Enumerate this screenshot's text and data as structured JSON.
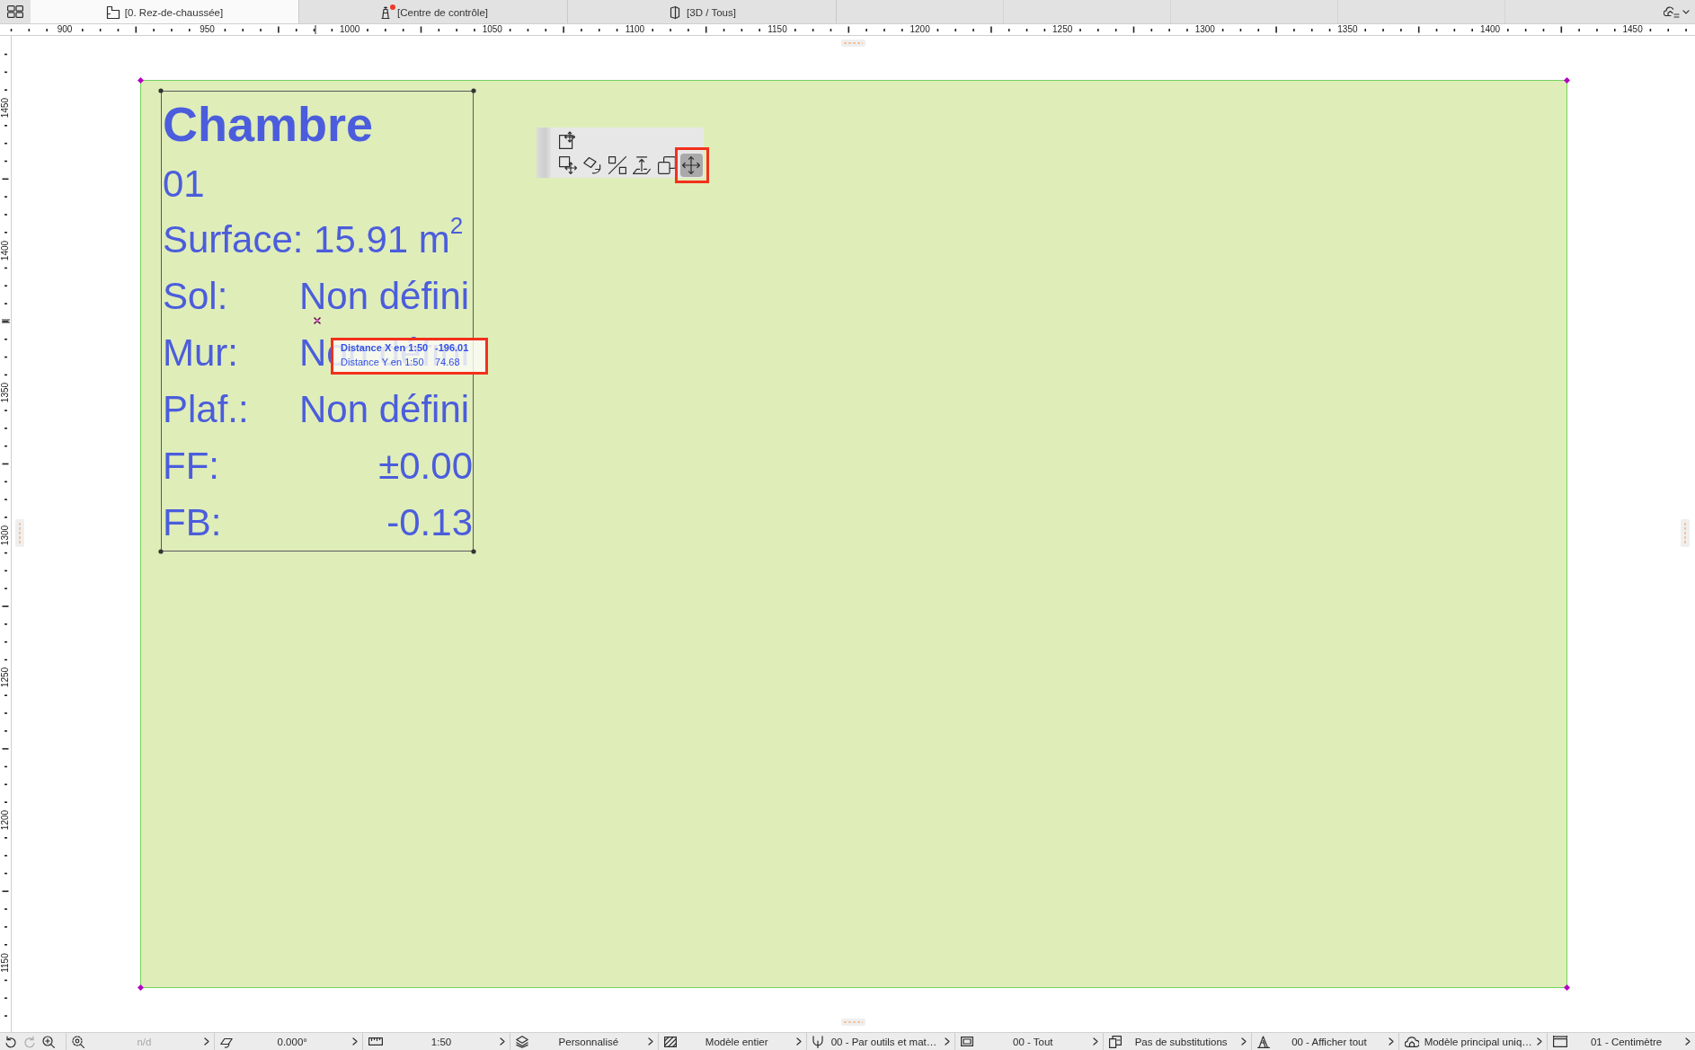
{
  "tab_bar": {
    "tabs": [
      {
        "label": "[0. Rez-de-chaussée]",
        "selected": true,
        "notification": false
      },
      {
        "label": "[Centre de contrôle]",
        "selected": false,
        "notification": true
      },
      {
        "label": "[3D / Tous]",
        "selected": false,
        "notification": false
      }
    ]
  },
  "rulers": {
    "horizontal": [
      "900",
      "950",
      "1000",
      "1050",
      "1100",
      "1150",
      "1200",
      "1250",
      "1300",
      "1350",
      "1400",
      "1450"
    ],
    "vertical": [
      "1450",
      "1400",
      "1350",
      "1300",
      "1250",
      "1200",
      "1150"
    ]
  },
  "canvas": {
    "room_label": {
      "name": "Chambre",
      "number": "01",
      "area": "Surface: 15.91 m$^{2}$",
      "fields": [
        {
          "kind": "material",
          "label": "Sol:",
          "value": "Non défini"
        },
        {
          "kind": "material",
          "label": "Mur:",
          "value": "Non défini"
        },
        {
          "kind": "material",
          "label": "Plaf.:",
          "value": "Non défini"
        },
        {
          "kind": "elevation",
          "label": "FF:",
          "value": "±0.00"
        },
        {
          "kind": "elevation",
          "label": "FB:",
          "value": "-0.13"
        }
      ]
    },
    "palette": {
      "top": [
        {
          "selected": false,
          "highlighted": false
        }
      ],
      "bottom": [
        {
          "selected": false,
          "highlighted": false
        },
        {
          "selected": false,
          "highlighted": false
        },
        {
          "selected": false,
          "highlighted": false
        },
        {
          "selected": false,
          "highlighted": false
        },
        {
          "selected": false,
          "highlighted": false
        },
        {
          "selected": true,
          "highlighted": true
        }
      ]
    },
    "tooltip": {
      "highlighted": true,
      "rows": [
        {
          "label": "Distance X en 1:50",
          "value": "-196.01",
          "active": true
        },
        {
          "label": "Distance Y en 1:50",
          "value": "74.68",
          "active": false
        }
      ]
    }
  },
  "status_bar": {
    "nav_buttons": [
      {
        "disabled": false
      },
      {
        "disabled": true
      },
      {
        "disabled": false
      }
    ],
    "segments": [
      {
        "value": "n/d",
        "disabled": true
      },
      {
        "value": "0.000°",
        "disabled": false
      },
      {
        "value": "1:50",
        "disabled": false
      },
      {
        "value": "Personnalisé",
        "disabled": false
      },
      {
        "value": "Modèle entier",
        "disabled": false
      },
      {
        "value": "00 - Par outils et mat…",
        "disabled": false
      },
      {
        "value": "00 - Tout",
        "disabled": false
      },
      {
        "value": "Pas de substitutions",
        "disabled": false
      },
      {
        "value": "00 - Afficher tout",
        "disabled": false
      },
      {
        "value": "Modèle principal uniq…",
        "disabled": false
      },
      {
        "value": "01 - Centimètre",
        "disabled": false
      }
    ]
  }
}
